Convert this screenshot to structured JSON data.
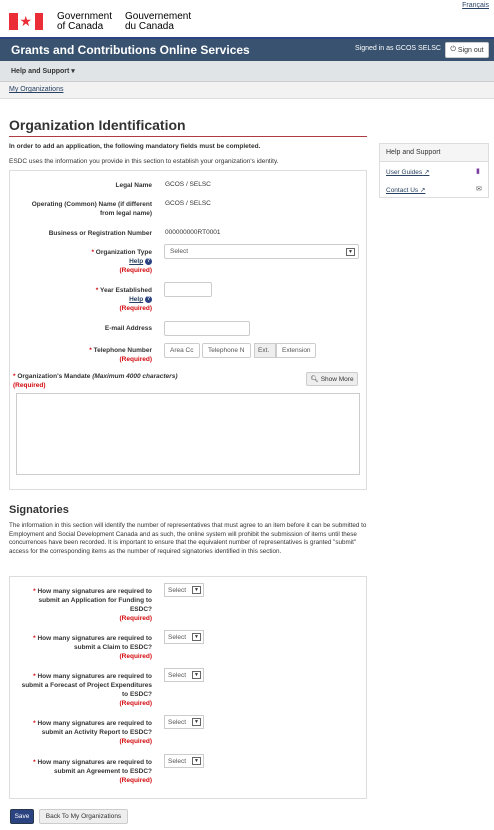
{
  "header": {
    "language_link": "Français",
    "gov_en_line1": "Government",
    "gov_en_line2": "of Canada",
    "gov_fr_line1": "Gouvernement",
    "gov_fr_line2": "du Canada",
    "app_title": "Grants and Contributions Online Services",
    "signed_in": "Signed in as GCOS SELSC",
    "sign_out": "Sign out"
  },
  "menu": {
    "help_support": "Help and Support"
  },
  "breadcrumb": {
    "my_organizations": "My Organizations"
  },
  "page": {
    "title": "Organization Identification",
    "mandatory_note": "In order to add an application, the following mandatory fields must be completed.",
    "esdc_note": "ESDC uses the information you provide in this section to establish your organization's identity."
  },
  "form": {
    "legal_name_label": "Legal Name",
    "legal_name_value": "GCOS / SELSC",
    "operating_name_label_1": "Operating (Common) Name (if different",
    "operating_name_label_2": "from legal name)",
    "operating_name_value": "GCOS / SELSC",
    "bn_label": "Business or Registration Number",
    "bn_value": "000000000RT0001",
    "org_type_label": "Organization Type",
    "org_type_value": "Select",
    "year_label": "Year Established",
    "email_label": "E-mail Address",
    "phone_label": "Telephone Number",
    "area_code_placeholder": "Area Cc",
    "phone_placeholder": "Telephone N",
    "ext_label": "Ext.",
    "ext_placeholder": "Extension",
    "mandate_label": "Organization's Mandate",
    "mandate_hint": "(Maximum 4000 characters)",
    "show_more": "Show More",
    "help": "Help",
    "required": "(Required)",
    "star": "*"
  },
  "side_panel": {
    "heading": "Help and Support",
    "user_guides": "User Guides",
    "contact_us": "Contact Us"
  },
  "signatories": {
    "title": "Signatories",
    "description": "The information in this section will identify the number of representatives that must agree to an item before it can be submitted to Employment and Social Development Canada and as such, the online system will prohibit the submission of items until these concurrences have been recorded. It is important to ensure that the equivalent number of representatives is granted \"submit\" access for the corresponding items as the number of required signatories identified in this section.",
    "select_value": "Select",
    "q1": [
      "How many signatures are required to",
      "submit an Application for Funding to",
      "ESDC?"
    ],
    "q2": [
      "How many signatures are required to",
      "submit a Claim to ESDC?"
    ],
    "q3": [
      "How many signatures are required to",
      "submit a Forecast of Project Expenditures",
      "to ESDC?"
    ],
    "q4": [
      "How many signatures are required to",
      "submit an Activity Report to ESDC?"
    ],
    "q5": [
      "How many signatures are required to",
      "submit an Agreement to ESDC?"
    ]
  },
  "actions": {
    "save": "Save",
    "back": "Back To My Organizations"
  },
  "colors": {
    "brand_bar": "#38526f",
    "required_red": "#d3080c",
    "flag_red": "#eb2d37"
  }
}
